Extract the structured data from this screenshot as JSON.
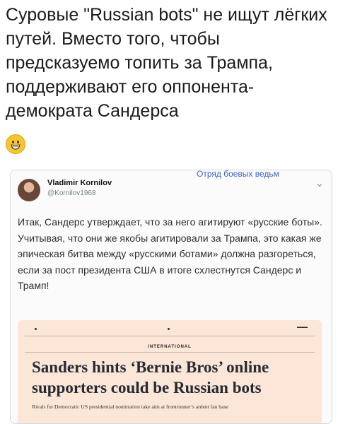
{
  "post": {
    "headline": "Суровые \"Russian bots\" не ищут лёгких путей. Вместо того, чтобы предсказуемо топить за Трампа, поддерживают его оппонента-демократа Сандерса",
    "emoji": "grinning-face-icon"
  },
  "watermark": "Отряд боевых ведьм",
  "tweet": {
    "author_name": "Vladimir Kornilov",
    "author_handle": "@Kornilov1968",
    "text": "Итак, Сандерс утверждает, что за него агитируют «русские боты». Учитывая, что они же якобы агитировали за Трампа, это какая же эпическая битва между «русскими ботами» должна разгореться, если за пост президента США в итоге схлестнутся Сандерс и Трамп!"
  },
  "article": {
    "section": "INTERNATIONAL",
    "headline": "Sanders hints ‘Bernie Bros’ online supporters could be Russian bots",
    "standfirst": "Rivals for Democratic US presidential nomination take aim at frontrunner’s ardent fan base"
  },
  "colors": {
    "watermark": "#3b63c8",
    "article_bg": "#fbe6d8"
  }
}
